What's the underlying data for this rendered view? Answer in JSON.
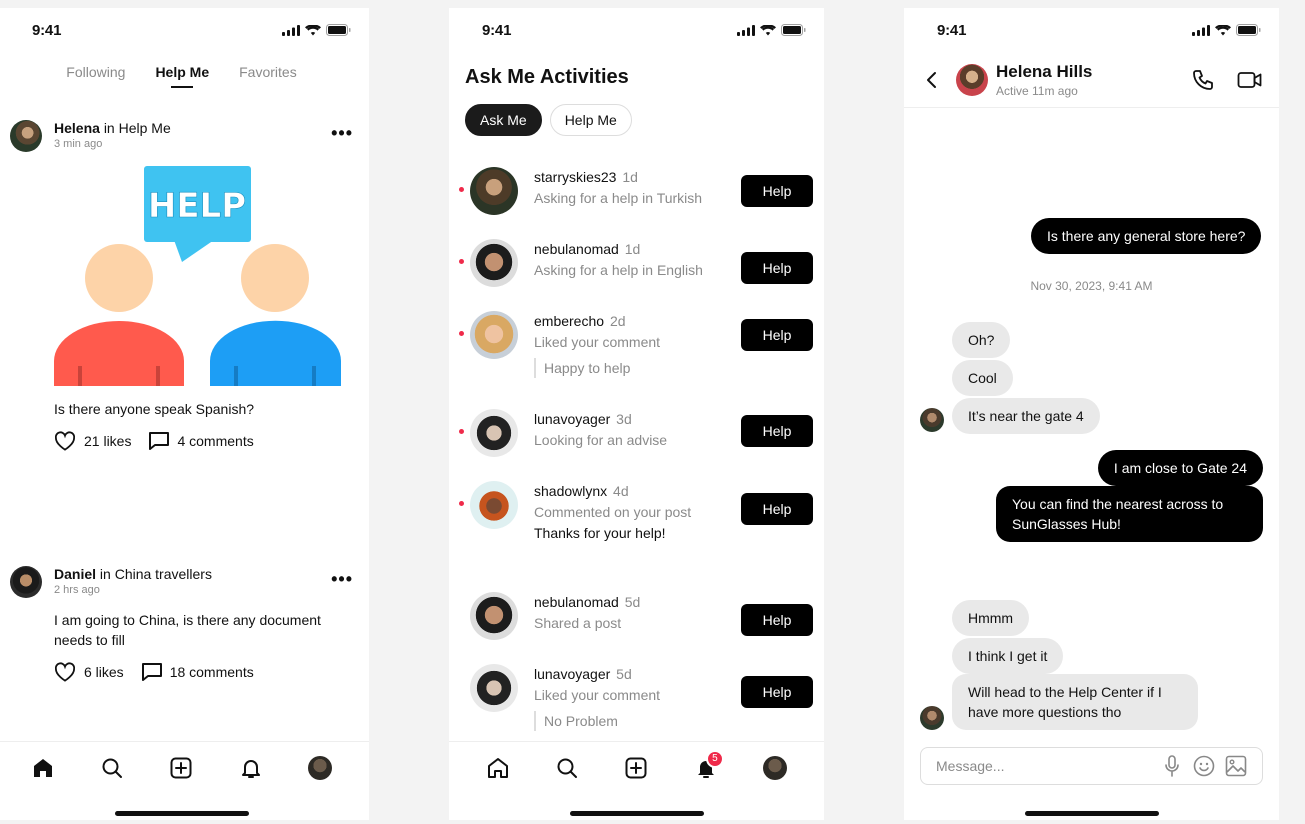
{
  "status": {
    "time": "9:41"
  },
  "feed": {
    "tabs": [
      {
        "label": "Following"
      },
      {
        "label": "Help Me"
      },
      {
        "label": "Favorites"
      }
    ],
    "illustration_text": "HELP",
    "posts": [
      {
        "author": "Helena",
        "in_text": "in",
        "group": "Help Me",
        "time": "3 min ago",
        "text": "Is there anyone speak Spanish?",
        "likes": "21 likes",
        "comments": "4 comments"
      },
      {
        "author": "Daniel",
        "in_text": "in",
        "group": "China travellers",
        "time": "2 hrs ago",
        "text": "I am going to China, is there any document needs to fill",
        "likes": "6 likes",
        "comments": "18 comments"
      }
    ]
  },
  "activities": {
    "title": "Ask Me Activities",
    "chips": [
      {
        "label": "Ask Me"
      },
      {
        "label": "Help Me"
      }
    ],
    "help_label": "Help",
    "items": [
      {
        "user": "starryskies23",
        "ago": "1d",
        "sub": "Asking for a help in Turkish"
      },
      {
        "user": "nebulanomad",
        "ago": "1d",
        "sub": "Asking for a help in English"
      },
      {
        "user": "emberecho",
        "ago": "2d",
        "sub": "Liked your comment",
        "quote": "Happy to help"
      },
      {
        "user": "lunavoyager",
        "ago": "3d",
        "sub": "Looking for an advise"
      },
      {
        "user": "shadowlynx",
        "ago": "4d",
        "sub": "Commented on your post",
        "extra": "Thanks for your help!"
      },
      {
        "user": "nebulanomad",
        "ago": "5d",
        "sub": "Shared a post"
      },
      {
        "user": "lunavoyager",
        "ago": "5d",
        "sub": "Liked your comment",
        "quote": "No Problem"
      }
    ],
    "notification_badge": "5"
  },
  "chat": {
    "contact_name": "Helena Hills",
    "contact_status": "Active 11m ago",
    "date": "Nov 30, 2023, 9:41 AM",
    "messages": [
      "Is there any general store here?",
      "Oh?",
      "Cool",
      "It’s near the gate 4",
      "I am close to Gate 24",
      "You can find the nearest across to",
      "SunGlasses Hub!",
      "Hmmm",
      "I think I get it",
      "Will head to the Help Center if I",
      "have more questions tho"
    ],
    "input_placeholder": "Message..."
  }
}
